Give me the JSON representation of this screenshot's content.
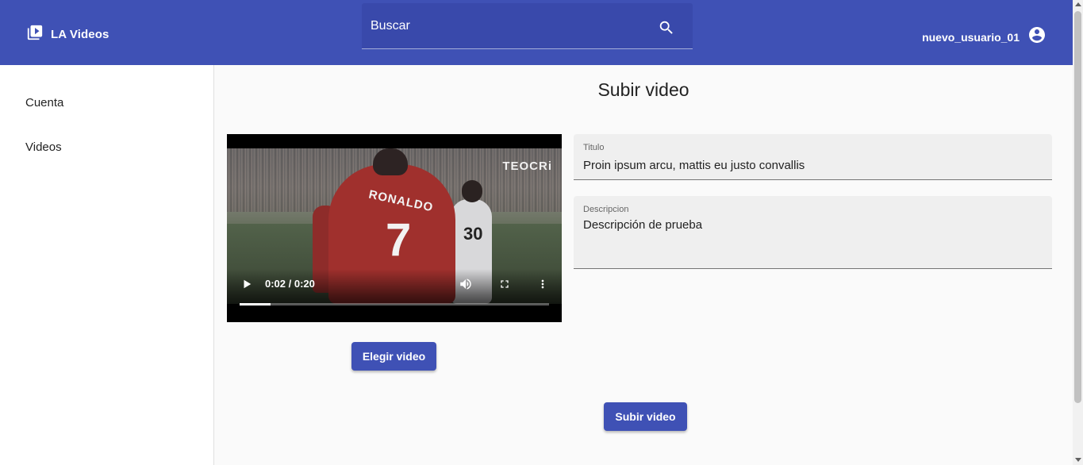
{
  "header": {
    "app_name": "LA Videos",
    "app_icon": "video-library-icon",
    "search": {
      "placeholder": "Buscar",
      "value": "",
      "icon": "search-icon"
    },
    "user": {
      "username": "nuevo_usuario_01",
      "icon": "account-circle-icon"
    },
    "background_color": "#3f51b5"
  },
  "sidebar": {
    "items": [
      {
        "label": "Cuenta"
      },
      {
        "label": "Videos"
      }
    ]
  },
  "main": {
    "title": "Subir video",
    "video_player": {
      "time_display": "0:02 / 0:20",
      "progress": 0.1,
      "frame_text": {
        "jersey_name": "RONALDO",
        "jersey_number": "7",
        "opponent_number": "30",
        "watermark": "TEOCRi"
      },
      "controls": [
        "play-icon",
        "volume-icon",
        "fullscreen-icon",
        "more-vert-icon"
      ]
    },
    "choose_video_label": "Elegir video",
    "form": {
      "title_label": "Titulo",
      "title_value": "Proin ipsum arcu, mattis eu justo convallis",
      "description_label": "Descripcion",
      "description_value": "Descripción de prueba"
    },
    "submit_label": "Subir video"
  }
}
